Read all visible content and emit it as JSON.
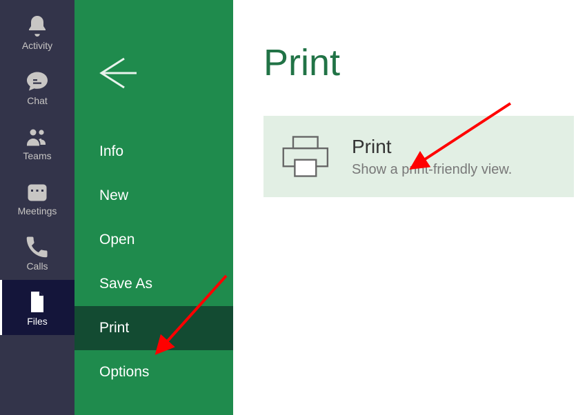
{
  "teams_rail": {
    "items": [
      {
        "label": "Activity"
      },
      {
        "label": "Chat"
      },
      {
        "label": "Teams"
      },
      {
        "label": "Meetings"
      },
      {
        "label": "Calls"
      },
      {
        "label": "Files"
      }
    ]
  },
  "file_menu": {
    "items": [
      {
        "label": "Info"
      },
      {
        "label": "New"
      },
      {
        "label": "Open"
      },
      {
        "label": "Save As"
      },
      {
        "label": "Print"
      },
      {
        "label": "Options"
      }
    ],
    "selected_index": 4
  },
  "content": {
    "page_title": "Print",
    "print_card": {
      "title": "Print",
      "subtitle": "Show a print-friendly view."
    }
  }
}
